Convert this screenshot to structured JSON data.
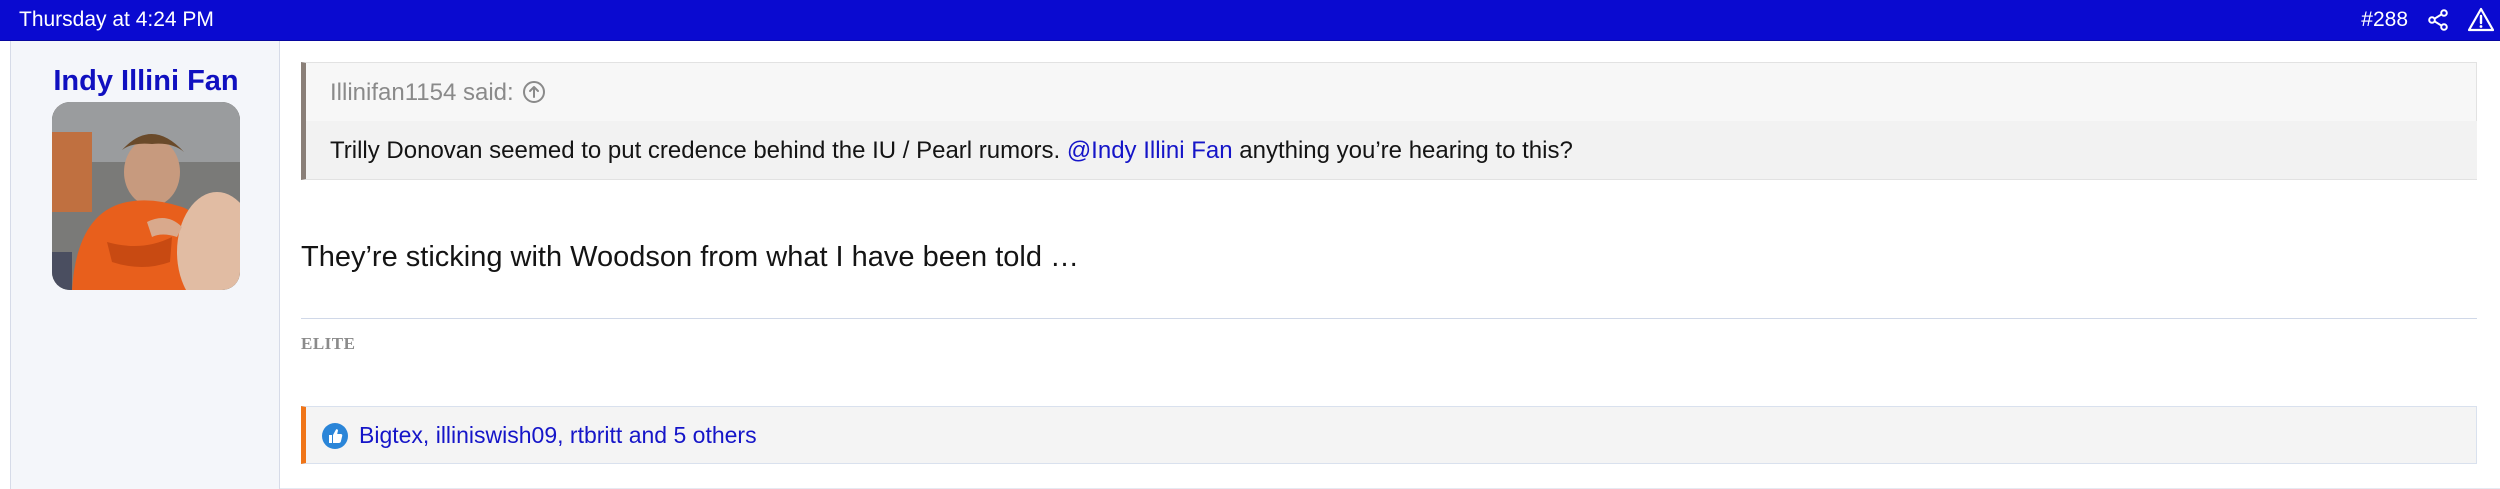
{
  "header": {
    "date": "Thursday at 4:24 PM",
    "post_number": "#288",
    "share_icon": "share-icon",
    "report_icon": "warning-triangle-icon",
    "colors": {
      "bar": "#0a0ad0",
      "text": "#ffffff"
    }
  },
  "user": {
    "name": "Indy Illini Fan",
    "rank": "ELITE"
  },
  "quote": {
    "attribution": "Illinifan1154 said:",
    "expand_icon": "arrow-up-circle-icon",
    "text_before": "Trilly Donovan seemed to put credence behind the IU / Pearl rumors. ",
    "mention": "@Indy Illini Fan",
    "text_after": " anything you’re hearing to this?"
  },
  "post": {
    "body": "They’re sticking with Woodson from what I have been told …"
  },
  "reactions": {
    "icon": "thumbs-up-icon",
    "likers_text": "Bigtex, illiniswish09, rtbritt and 5 others",
    "accent_color": "#f07518"
  }
}
